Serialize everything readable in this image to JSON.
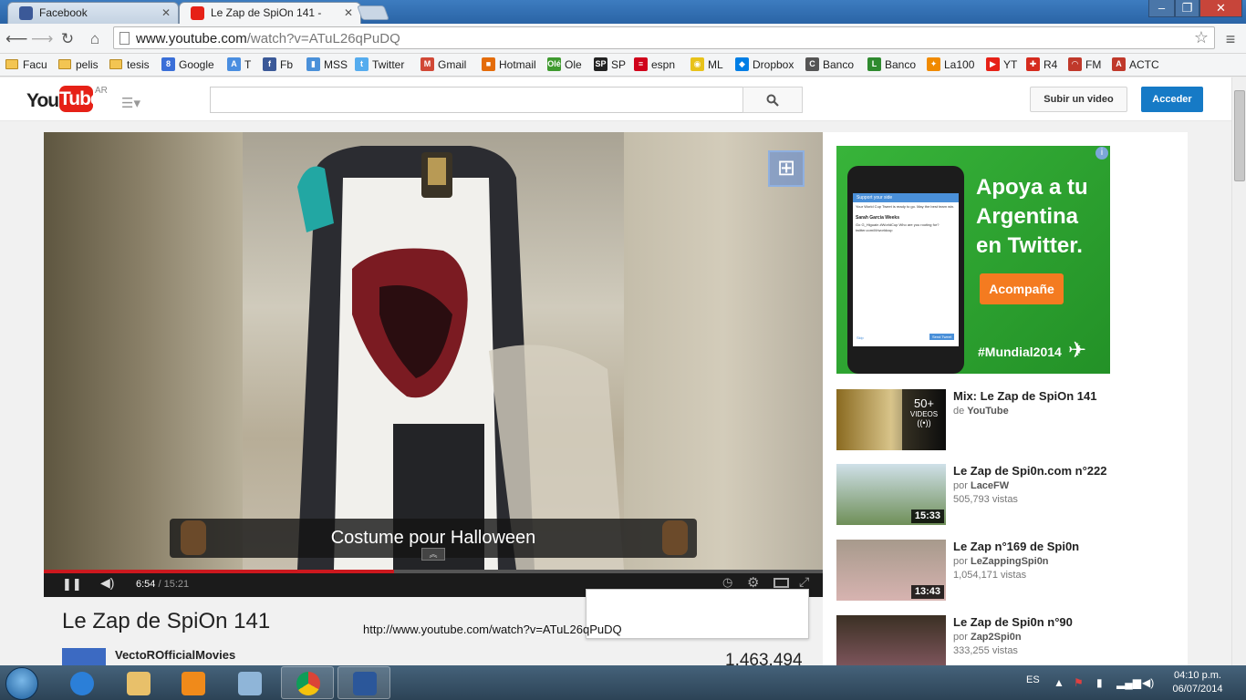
{
  "browser": {
    "tabs": [
      {
        "title": "Facebook",
        "favicon_color": "#3b5998",
        "active": false
      },
      {
        "title": "Le Zap de SpiOn 141 - ",
        "favicon_color": "#e62117",
        "active": true
      }
    ],
    "url_host": "www.youtube.com",
    "url_path": "/watch?v=ATuL26qPuDQ",
    "bookmarks": [
      {
        "label": "Facu",
        "icon": "folder-icon"
      },
      {
        "label": "pelis",
        "icon": "folder-icon"
      },
      {
        "label": "tesis",
        "icon": "folder-icon"
      },
      {
        "label": "Google",
        "icon": "google-icon",
        "color": "#3a6fd8",
        "glyph": "8"
      },
      {
        "label": "T",
        "icon": "translate-icon",
        "color": "#4a8ee0",
        "glyph": "A"
      },
      {
        "label": "Fb",
        "icon": "facebook-icon",
        "color": "#3b5998",
        "glyph": "f"
      },
      {
        "label": "MSS",
        "icon": "bars-icon",
        "color": "#4a90d9",
        "glyph": "▮"
      },
      {
        "label": "Twitter",
        "icon": "twitter-icon",
        "color": "#55acee",
        "glyph": "t"
      },
      {
        "label": "Gmail",
        "icon": "gmail-icon",
        "color": "#d14836",
        "glyph": "M"
      },
      {
        "label": "Hotmail",
        "icon": "hotmail-icon",
        "color": "#e46c0a",
        "glyph": "■"
      },
      {
        "label": "Ole",
        "icon": "ole-icon",
        "color": "#3f9a2f",
        "glyph": "Olé"
      },
      {
        "label": "SP",
        "icon": "sp-icon",
        "color": "#222222",
        "glyph": "SP"
      },
      {
        "label": "espn",
        "icon": "espn-icon",
        "color": "#d0021b",
        "glyph": "≡"
      },
      {
        "label": "ML",
        "icon": "mercadolibre-icon",
        "color": "#e8c21a",
        "glyph": "◉"
      },
      {
        "label": "Dropbox",
        "icon": "dropbox-icon",
        "color": "#007ee5",
        "glyph": "◆"
      },
      {
        "label": "Banco",
        "icon": "bank-icon",
        "color": "#555555",
        "glyph": "C"
      },
      {
        "label": "Banco",
        "icon": "link-bank-icon",
        "color": "#2f8a2f",
        "glyph": "L"
      },
      {
        "label": "La100",
        "icon": "radio-icon",
        "color": "#f08a00",
        "glyph": "✦"
      },
      {
        "label": "YT",
        "icon": "youtube-icon",
        "color": "#e62117",
        "glyph": "▶"
      },
      {
        "label": "R4",
        "icon": "r4-icon",
        "color": "#d52b1e",
        "glyph": "✚"
      },
      {
        "label": "FM",
        "icon": "fm-icon",
        "color": "#c0392b",
        "glyph": "◠"
      },
      {
        "label": "ACTC",
        "icon": "actc-icon",
        "color": "#c0392b",
        "glyph": "A"
      }
    ]
  },
  "youtube": {
    "logo_you": "You",
    "logo_tube": "Tube",
    "logo_region": "AR",
    "upload_label": "Subir un video",
    "signin_label": "Acceder",
    "player": {
      "subtitle": "Costume pour Halloween",
      "current_time": "6:54",
      "duration": " / 15:21",
      "progress_fraction": 0.45
    },
    "video_title": "Le Zap de SpiOn 141",
    "channel": "VectoROfficialMovies",
    "views": "1.463.494",
    "hover_url": "http://www.youtube.com/watch?v=ATuL26qPuDQ",
    "ad": {
      "headline_1": "Apoya a tu",
      "headline_2": "Argentina",
      "headline_3": "en Twitter.",
      "cta": "Acompañe",
      "hashtag": "#Mundial2014",
      "phone_header": "Support your side",
      "phone_line": "Your World Cup Tweet is ready to go. May the best team win.",
      "phone_user": "Sarah Garcia Weeks",
      "phone_tweet": "Go G_Higuain #WorldCup Who are you rooting for? twitter.com/i/t/worldcup",
      "phone_skip": "Skip",
      "phone_send": "Send Tweet"
    },
    "recommendations": [
      {
        "title": "Mix: Le Zap de SpiOn 141",
        "by_prefix": "de ",
        "by": "YouTube",
        "views": "",
        "badge_count": "50+",
        "badge_label": "VIDEOS",
        "duration": ""
      },
      {
        "title": "Le Zap de Spi0n.com n°222",
        "by_prefix": "por ",
        "by": "LaceFW",
        "views": "505,793 vistas",
        "duration": "15:33"
      },
      {
        "title": "Le Zap n°169 de Spi0n",
        "by_prefix": "por ",
        "by": "LeZappingSpi0n",
        "views": "1,054,171 vistas",
        "duration": "13:43"
      },
      {
        "title": "Le Zap de Spi0n n°90",
        "by_prefix": "por ",
        "by": "Zap2Spi0n",
        "views": "333,255 vistas",
        "duration": ""
      }
    ]
  },
  "taskbar": {
    "language": "ES",
    "time": "04:10 p.m.",
    "date": "06/07/2014"
  }
}
